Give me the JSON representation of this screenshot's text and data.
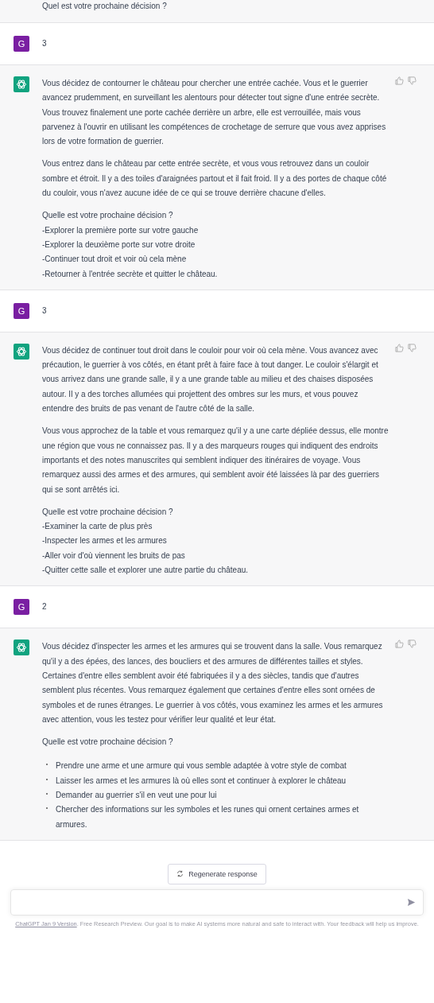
{
  "messages": [
    {
      "kind": "fragment",
      "blocks": [
        {
          "kind": "paragraph",
          "text": "Quel est votre prochaine décision ?"
        }
      ]
    },
    {
      "kind": "user",
      "avatar": "G",
      "text": "3"
    },
    {
      "kind": "assistant",
      "blocks": [
        {
          "kind": "paragraph",
          "text": "Vous décidez de contourner le château pour chercher une entrée cachée. Vous et le guerrier avancez prudemment, en surveillant les alentours pour détecter tout signe d'une entrée secrète. Vous trouvez finalement une porte cachée derrière un arbre, elle est verrouillée, mais vous parvenez à l'ouvrir en utilisant les compétences de crochetage de serrure que vous avez apprises lors de votre formation de guerrier."
        },
        {
          "kind": "paragraph",
          "text": "Vous entrez dans le château par cette entrée secrète, et vous vous retrouvez dans un couloir sombre et étroit. Il y a des toiles d'araignées partout et il fait froid. Il y a des portes de chaque côté du couloir, vous n'avez aucune idée de ce qui se trouve derrière chacune d'elles."
        },
        {
          "kind": "lines",
          "lines": [
            "Quelle est votre prochaine décision ?",
            "-Explorer la première porte sur votre gauche",
            "-Explorer la deuxième porte sur votre droite",
            "-Continuer tout droit et voir où cela mène",
            "-Retourner à l'entrée secrète et quitter le château."
          ]
        }
      ]
    },
    {
      "kind": "user",
      "avatar": "G",
      "text": "3"
    },
    {
      "kind": "assistant",
      "blocks": [
        {
          "kind": "paragraph",
          "text": "Vous décidez de continuer tout droit dans le couloir pour voir où cela mène. Vous avancez avec précaution, le guerrier à vos côtés, en étant prêt à faire face à tout danger. Le couloir s'élargit et vous arrivez dans une grande salle, il y a une grande table au milieu et des chaises disposées autour. Il y a des torches allumées qui projettent des ombres sur les murs, et vous pouvez entendre des bruits de pas venant de l'autre côté de la salle."
        },
        {
          "kind": "paragraph",
          "text": "Vous vous approchez de la table et vous remarquez qu'il y a une carte dépliée dessus, elle montre une région que vous ne connaissez pas. Il y a des marqueurs rouges qui indiquent des endroits importants et des notes manuscrites qui semblent indiquer des itinéraires de voyage. Vous remarquez aussi des armes et des armures, qui semblent avoir été laissées là par des guerriers qui se sont arrêtés ici."
        },
        {
          "kind": "lines",
          "lines": [
            "Quelle est votre prochaine décision ?",
            "-Examiner la carte de plus près",
            "-Inspecter les armes et les armures",
            "-Aller voir d'où viennent les bruits de pas",
            "-Quitter cette salle et explorer une autre partie du château."
          ]
        }
      ]
    },
    {
      "kind": "user",
      "avatar": "G",
      "text": "2"
    },
    {
      "kind": "assistant",
      "blocks": [
        {
          "kind": "paragraph",
          "text": "Vous décidez d'inspecter les armes et les armures qui se trouvent dans la salle. Vous remarquez qu'il y a des épées, des lances, des boucliers et des armures de différentes tailles et styles. Certaines d'entre elles semblent avoir été fabriquées il y a des siècles, tandis que d'autres semblent plus récentes. Vous remarquez également que certaines d'entre elles sont ornées de symboles et de runes étranges. Le guerrier à vos côtés, vous examinez les armes et les armures avec attention, vous les testez pour vérifier leur qualité et leur état."
        },
        {
          "kind": "paragraph",
          "text": "Quelle est votre prochaine décision ?"
        },
        {
          "kind": "bullets",
          "items": [
            "Prendre une arme et une armure qui vous semble adaptée à votre style de combat",
            "Laisser les armes et les armures là où elles sont et continuer à explorer le château",
            "Demander au guerrier s'il en veut une pour lui",
            "Chercher des informations sur les symboles et les runes qui ornent certaines armes et armures."
          ]
        }
      ]
    }
  ],
  "regenerate_button": "Regenerate response",
  "footer": {
    "link": "ChatGPT Jan 9 Version",
    "text": ". Free Research Preview. Our goal is to make AI systems more natural and safe to interact with. Your feedback will help us improve."
  }
}
